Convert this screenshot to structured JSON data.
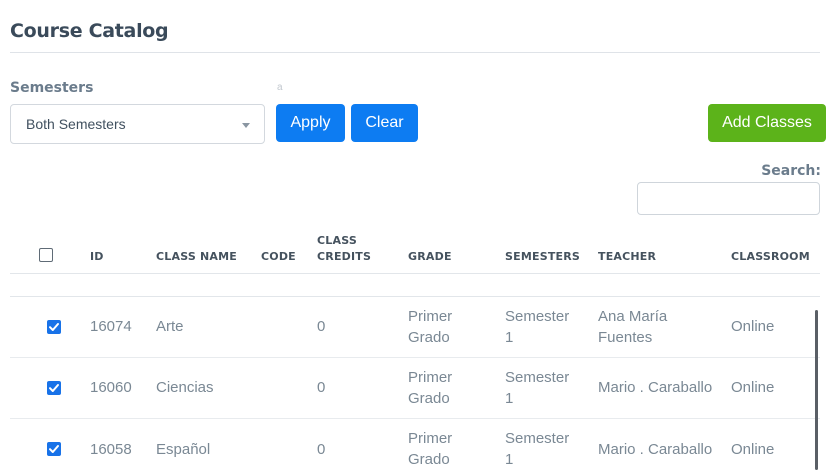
{
  "page": {
    "title": "Course Catalog"
  },
  "filter": {
    "label": "Semesters",
    "mark": "a",
    "selected": "Both Semesters",
    "apply_label": "Apply",
    "clear_label": "Clear"
  },
  "actions": {
    "add_label": "Add Classes"
  },
  "search": {
    "label": "Search:",
    "value": ""
  },
  "table": {
    "columns": {
      "id": "ID",
      "class_name": "CLASS NAME",
      "code": "CODE",
      "credits_line1": "CLASS",
      "credits_line2": "CREDITS",
      "grade": "GRADE",
      "semesters": "SEMESTERS",
      "teacher": "TEACHER",
      "classroom": "CLASSROOM"
    },
    "rows": [
      {
        "checked": true,
        "id": "16074",
        "class_name": "Arte",
        "code": "",
        "credits": "0",
        "grade_l1": "Primer",
        "grade_l2": "Grado",
        "sem_l1": "Semester",
        "sem_l2": "1",
        "teacher_l1": "Ana María",
        "teacher_l2": "Fuentes",
        "classroom": "Online"
      },
      {
        "checked": true,
        "id": "16060",
        "class_name": "Ciencias",
        "code": "",
        "credits": "0",
        "grade_l1": "Primer",
        "grade_l2": "Grado",
        "sem_l1": "Semester",
        "sem_l2": "1",
        "teacher_l1": "Mario . Caraballo",
        "teacher_l2": "",
        "classroom": "Online"
      },
      {
        "checked": true,
        "id": "16058",
        "class_name": "Español",
        "code": "",
        "credits": "0",
        "grade_l1": "Primer",
        "grade_l2": "Grado",
        "sem_l1": "Semester",
        "sem_l2": "1",
        "teacher_l1": "Mario . Caraballo",
        "teacher_l2": "",
        "classroom": "Online"
      }
    ]
  },
  "colors": {
    "primary": "#0d7cf2",
    "success": "#5cb31a",
    "checkbox": "#1872e8"
  },
  "icons": {
    "select_caret": "caret-down-icon",
    "check": "check-icon"
  }
}
